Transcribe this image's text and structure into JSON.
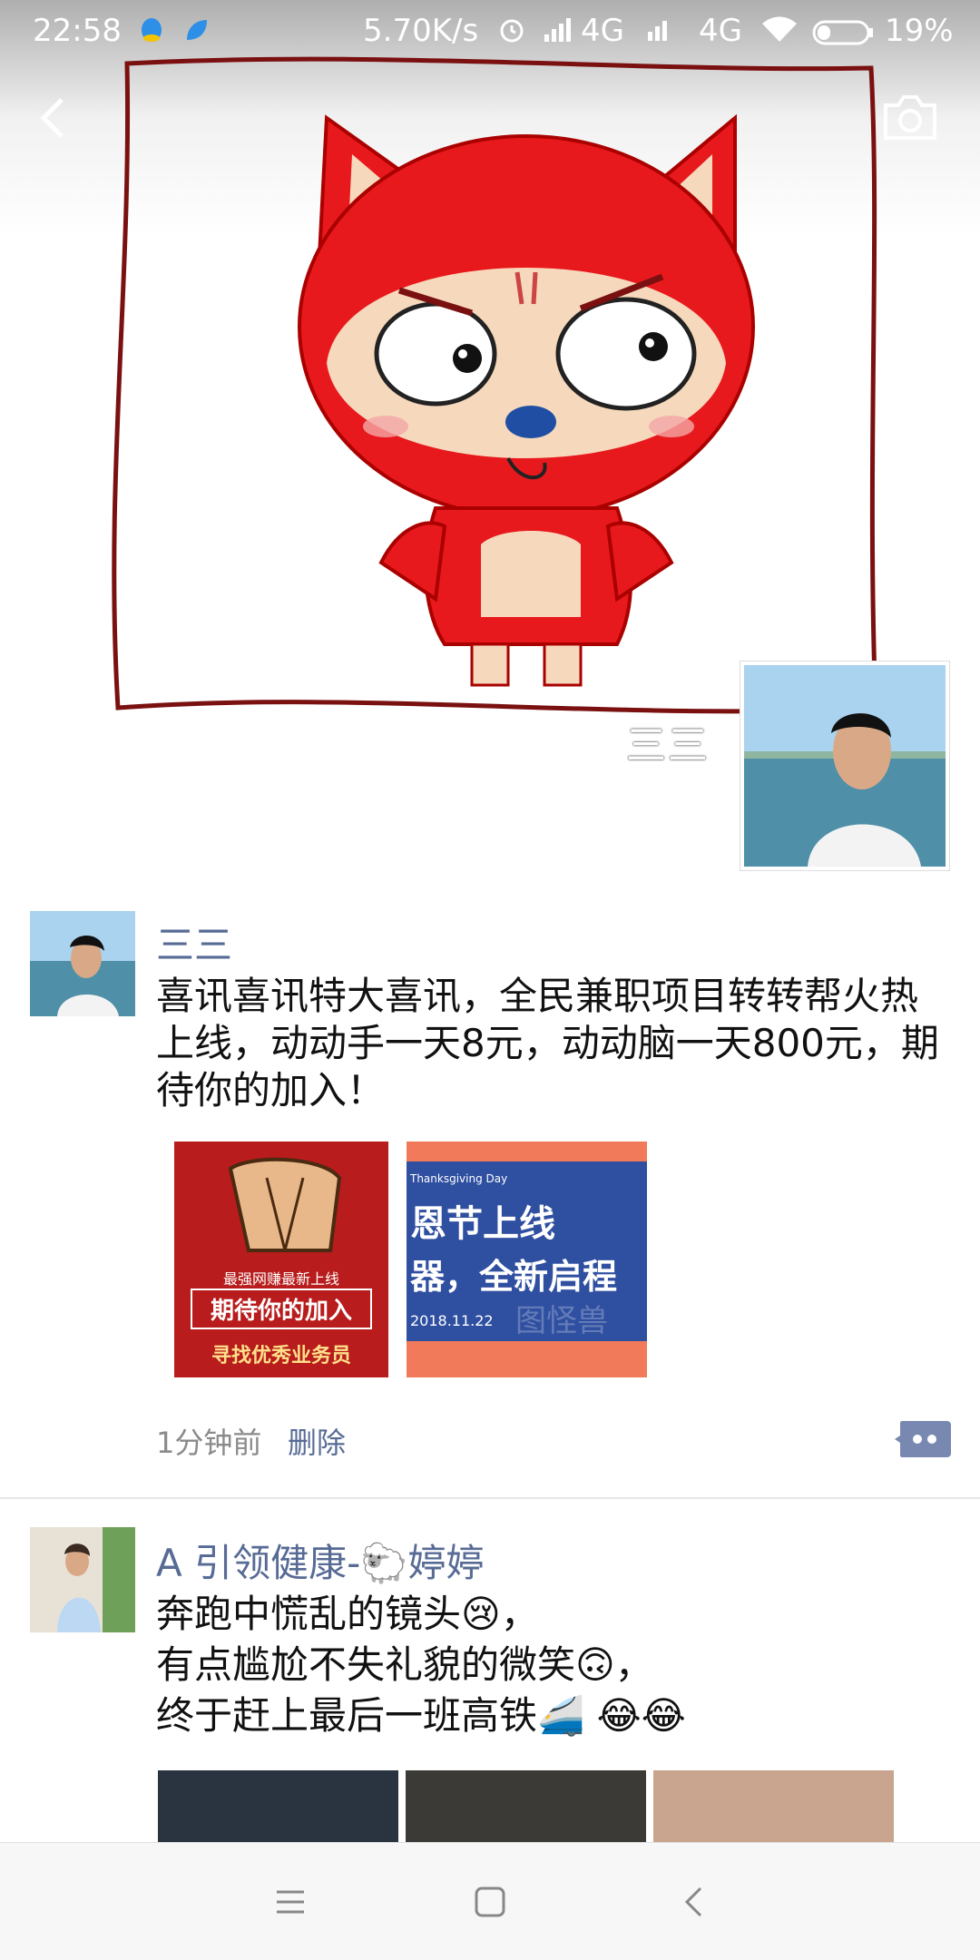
{
  "status_bar": {
    "time": "22:58",
    "network_speed": "5.70K/s",
    "signal_1": "4G",
    "signal_2": "4G",
    "battery": "19%"
  },
  "cover": {
    "profile_name": "三三"
  },
  "posts": [
    {
      "author": "三三",
      "text": "喜讯喜讯特大喜讯，全民兼职项目转转帮火热上线，动动手一天8元，动动脑一天800元，期待你的加入！",
      "images": [
        {
          "line1": "最强网赚最新上线",
          "line2": "期待你的加入",
          "line3": "寻找优秀业务员"
        },
        {
          "tag": "Thanksgiving Day",
          "line1": "恩节上线",
          "line2": "器，全新启程",
          "date": "2018.11.22",
          "watermark": "图怪兽"
        }
      ],
      "time": "1分钟前",
      "delete_label": "删除"
    },
    {
      "author": "A 引领健康-🐑婷婷",
      "lines": [
        "奔跑中慌乱的镜头😢，",
        "有点尴尬不失礼貌的微笑🙃，",
        "终于赶上最后一班高铁🚄 😂😂"
      ]
    }
  ],
  "colors": {
    "link": "#576b95",
    "fox_red": "#e8191d"
  }
}
